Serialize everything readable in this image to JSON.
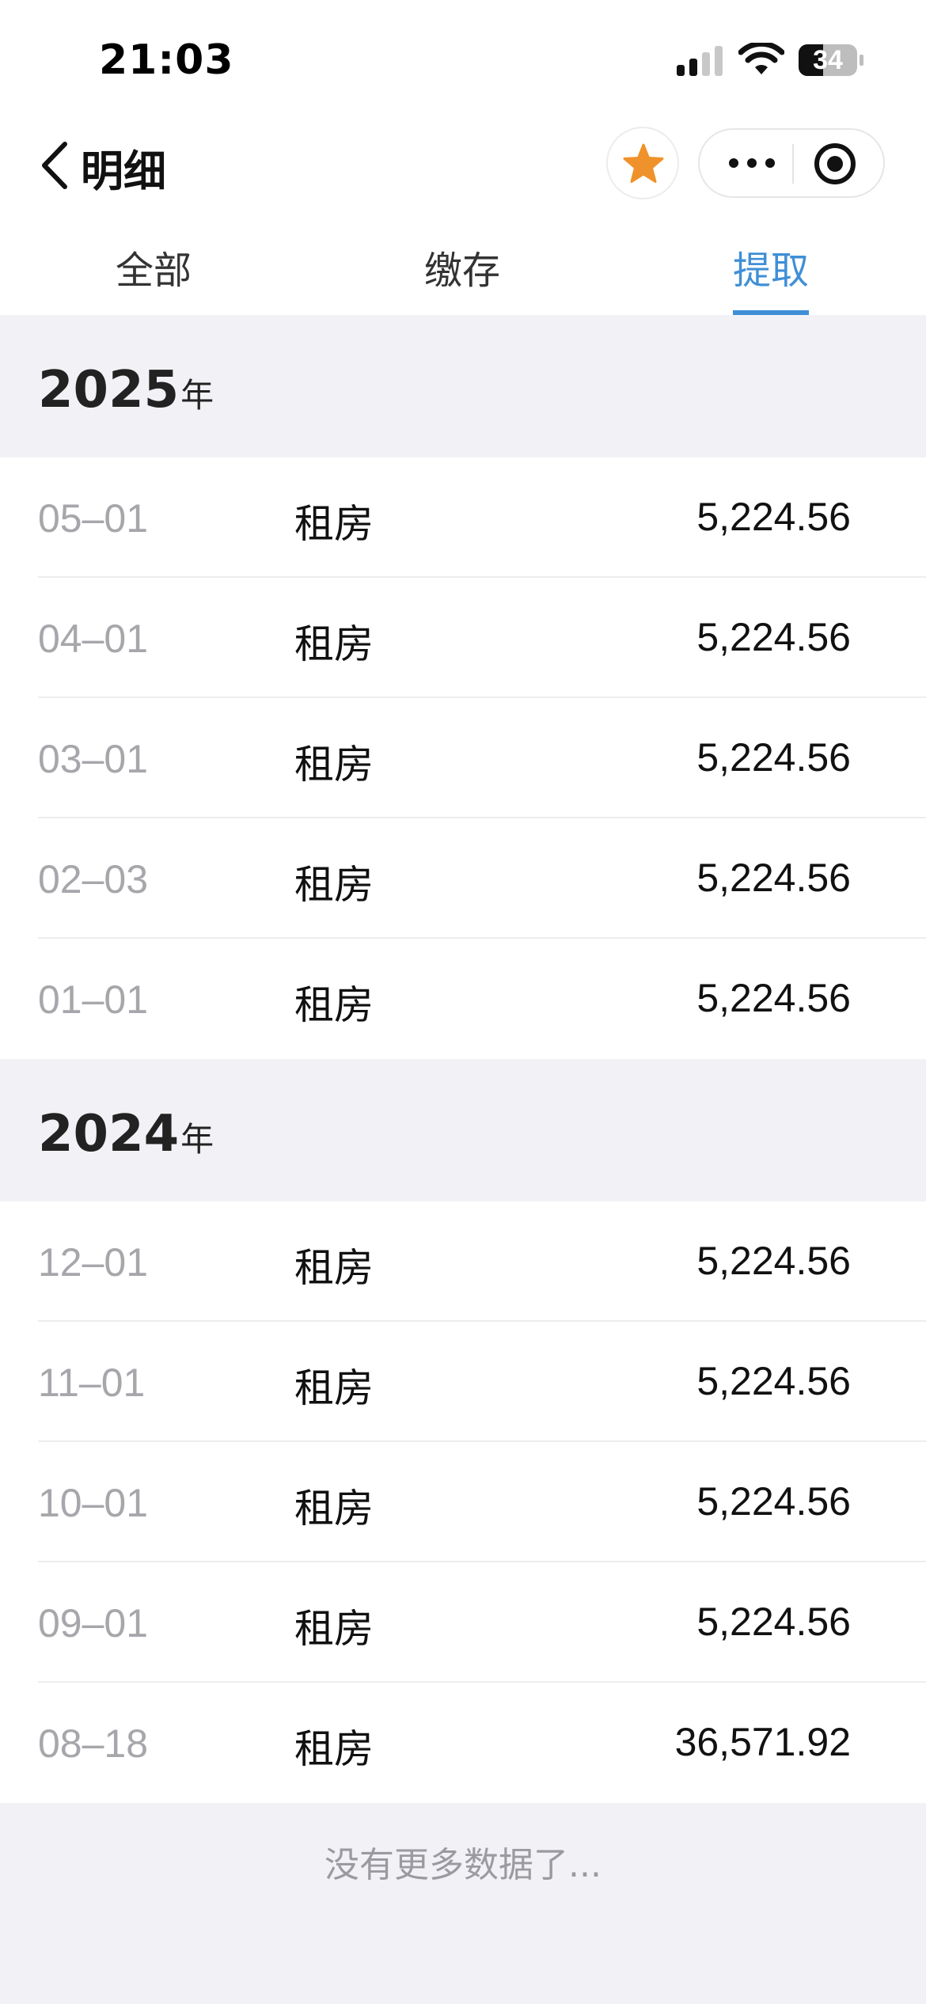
{
  "status_bar": {
    "time": "21:03",
    "battery": "34"
  },
  "nav": {
    "title": "明细"
  },
  "tabs": [
    {
      "label": "全部",
      "active": false
    },
    {
      "label": "缴存",
      "active": false
    },
    {
      "label": "提取",
      "active": true
    }
  ],
  "colors": {
    "accent": "#3f8fd6",
    "star": "#f0922b"
  },
  "sections": [
    {
      "year": "2025",
      "year_unit": "年",
      "records": [
        {
          "date": "05–01",
          "type": "租房",
          "amount": "5,224.56"
        },
        {
          "date": "04–01",
          "type": "租房",
          "amount": "5,224.56"
        },
        {
          "date": "03–01",
          "type": "租房",
          "amount": "5,224.56"
        },
        {
          "date": "02–03",
          "type": "租房",
          "amount": "5,224.56"
        },
        {
          "date": "01–01",
          "type": "租房",
          "amount": "5,224.56"
        }
      ]
    },
    {
      "year": "2024",
      "year_unit": "年",
      "records": [
        {
          "date": "12–01",
          "type": "租房",
          "amount": "5,224.56"
        },
        {
          "date": "11–01",
          "type": "租房",
          "amount": "5,224.56"
        },
        {
          "date": "10–01",
          "type": "租房",
          "amount": "5,224.56"
        },
        {
          "date": "09–01",
          "type": "租房",
          "amount": "5,224.56"
        },
        {
          "date": "08–18",
          "type": "租房",
          "amount": "36,571.92"
        }
      ]
    }
  ],
  "footer": {
    "no_more": "没有更多数据了..."
  }
}
